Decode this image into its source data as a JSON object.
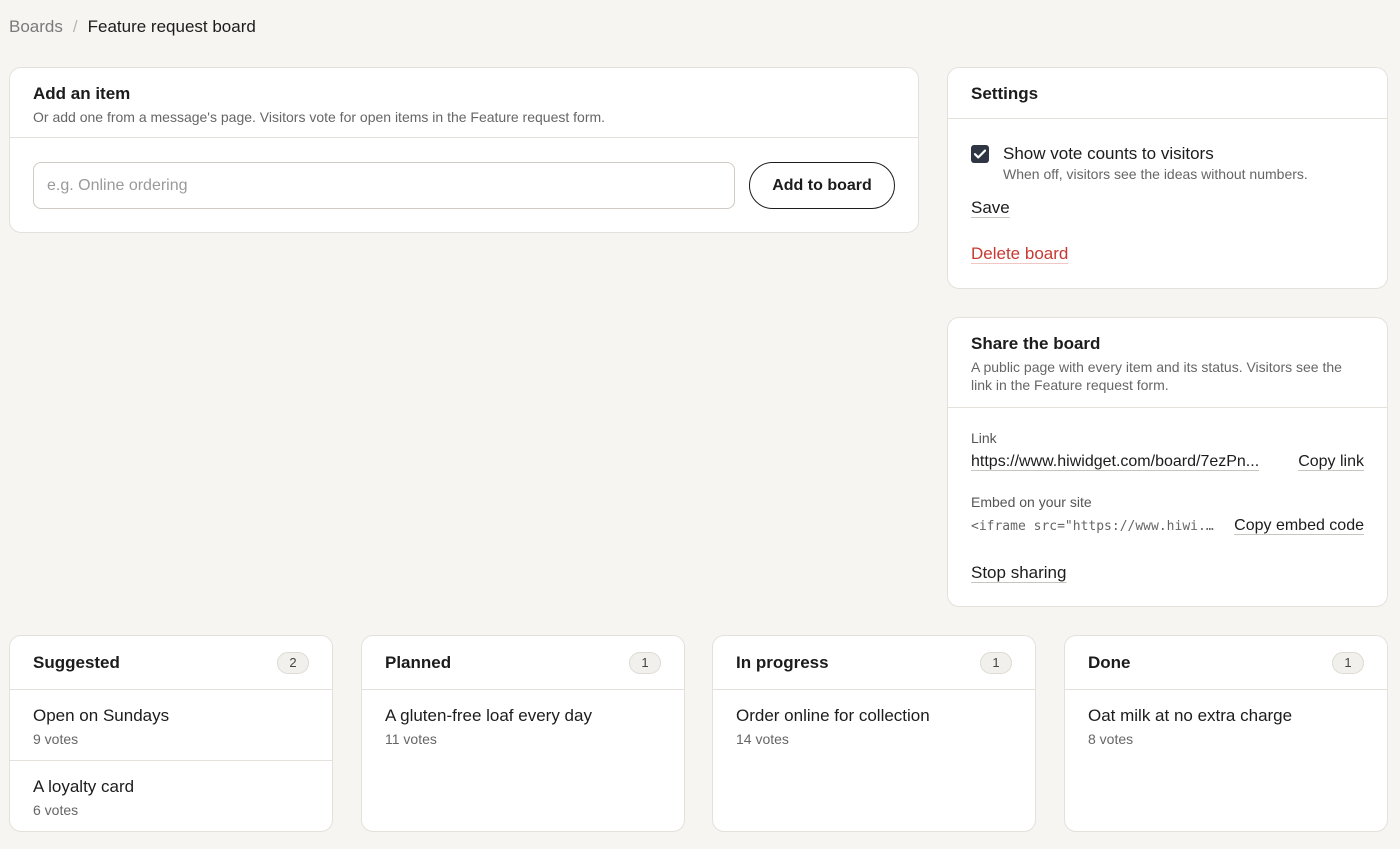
{
  "breadcrumb": {
    "parent": "Boards",
    "separator": "/",
    "current": "Feature request board"
  },
  "add_item": {
    "title": "Add an item",
    "description": "Or add one from a message's page. Visitors vote for open items in the Feature request form.",
    "input_placeholder": "e.g. Online ordering",
    "input_value": "",
    "button_label": "Add to board"
  },
  "settings": {
    "title": "Settings",
    "show_votes_label": "Show vote counts to visitors",
    "show_votes_hint": "When off, visitors see the ideas without numbers.",
    "show_votes_checked": true,
    "save_label": "Save",
    "delete_label": "Delete board"
  },
  "share": {
    "title": "Share the board",
    "description": "A public page with every item and its status. Visitors see the link in the Feature request form.",
    "link_label": "Link",
    "link_url": "https://www.hiwidget.com/board/7ezPn...",
    "copy_link_label": "Copy link",
    "embed_label": "Embed on your site",
    "embed_code": "<iframe src=\"https://www.hiwi...",
    "copy_embed_label": "Copy embed code",
    "stop_label": "Stop sharing"
  },
  "columns": [
    {
      "title": "Suggested",
      "count": "2",
      "items": [
        {
          "title": "Open on Sundays",
          "votes": "9 votes"
        },
        {
          "title": "A loyalty card",
          "votes": "6 votes"
        }
      ]
    },
    {
      "title": "Planned",
      "count": "1",
      "items": [
        {
          "title": "A gluten-free loaf every day",
          "votes": "11 votes"
        }
      ]
    },
    {
      "title": "In progress",
      "count": "1",
      "items": [
        {
          "title": "Order online for collection",
          "votes": "14 votes"
        }
      ]
    },
    {
      "title": "Done",
      "count": "1",
      "items": [
        {
          "title": "Oat milk at no extra charge",
          "votes": "8 votes"
        }
      ]
    }
  ],
  "colors": {
    "background": "#f7f5f1",
    "danger": "#c73a32",
    "checkbox": "#2f3542"
  }
}
